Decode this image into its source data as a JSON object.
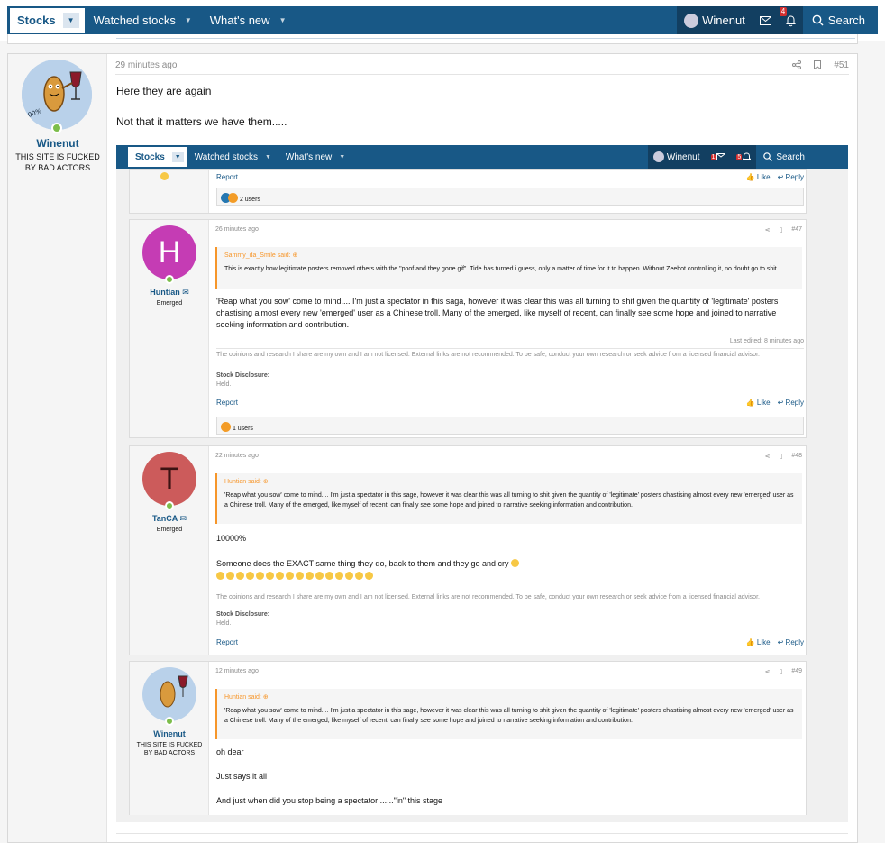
{
  "nav": {
    "tabs": [
      {
        "label": "Stocks"
      },
      {
        "label": "Watched stocks"
      },
      {
        "label": "What's new"
      }
    ],
    "user": "Winenut",
    "alert_count": "4",
    "search": "Search"
  },
  "post": {
    "author": "Winenut",
    "author_title": "THIS SITE IS FUCKED BY BAD ACTORS",
    "time": "29 minutes ago",
    "number": "#51",
    "line1": "Here they are again",
    "line2": "Not that it matters we have them....."
  },
  "shot": {
    "nav": {
      "tabs": [
        "Stocks",
        "Watched stocks",
        "What's new"
      ],
      "user": "Winenut",
      "conv_count": "1",
      "alert_count": "5",
      "search": "Search"
    },
    "top": {
      "report": "Report",
      "like": "Like",
      "reply": "Reply",
      "reactions": "2 users"
    },
    "posts": [
      {
        "initial": "H",
        "color": "#c53cb4",
        "author": "Huntian",
        "title": "Emerged",
        "time": "26 minutes ago",
        "number": "#47",
        "quote_author": "Sammy_da_Smile said:",
        "quote": "This is exactly how legitimate posters removed others with the \"poof and they gone gif\". Tide has turned i guess, only a matter of time for it to happen. Without Zeebot controlling it, no doubt go to shit.",
        "body": "'Reap what you sow' come to mind.... I'm just a spectator in this saga, however it was clear this was all turning to shit given the quantity of 'legitimate' posters chastising almost every new 'emerged' user as a Chinese troll. Many of the emerged, like myself of recent, can finally see some hope and joined to narrative seeking information and contribution.",
        "edited": "Last edited: 8 minutes ago",
        "signature": "The opinions and research I share are my own and I am not licensed. External links are not recommended. To be safe, conduct your own research or seek advice from a licensed financial advisor.",
        "disclosure_label": "Stock Disclosure:",
        "disclosure": "Held.",
        "report": "Report",
        "like": "Like",
        "reply": "Reply",
        "reactions": "1 users"
      },
      {
        "initial": "T",
        "color": "#cc5b5b",
        "author": "TanCA",
        "title": "Emerged",
        "time": "22 minutes ago",
        "number": "#48",
        "quote_author": "Huntian said:",
        "quote": "'Reap what you sow' come to mind.... I'm just a spectator in this sage, however it was clear this was all turning to shit given the quantity of 'legitimate' posters chastising almost every new 'emerged' user as a Chinese troll. Many of the emerged, like myself of recent, can finally see some hope and joined to narrative seeking information and contribution.",
        "body1": "10000%",
        "body2": "Someone does the EXACT same thing they do, back to them and they go and cry",
        "laugh_count": 16,
        "signature": "The opinions and research I share are my own and I am not licensed. External links are not recommended. To be safe, conduct your own research or seek advice from a licensed financial advisor.",
        "disclosure_label": "Stock Disclosure:",
        "disclosure": "Held.",
        "report": "Report",
        "like": "Like",
        "reply": "Reply"
      },
      {
        "author": "Winenut",
        "title": "THIS SITE IS FUCKED BY BAD ACTORS",
        "time": "12 minutes ago",
        "number": "#49",
        "quote_author": "Huntian said:",
        "quote": "'Reap what you sow' come to mind.... I'm just a spectator in this sage, however it was clear this was all turning to shit given the quantity of 'legitimate' posters chastising almost every new 'emerged' user as a Chinese troll. Many of the emerged, like myself of recent, can finally see some hope and joined to narrative seeking information and contribution.",
        "line1": "oh dear",
        "line2": "Just says it all",
        "line3": "And just when did you stop being a spectator ......\"in\" this stage"
      }
    ]
  }
}
